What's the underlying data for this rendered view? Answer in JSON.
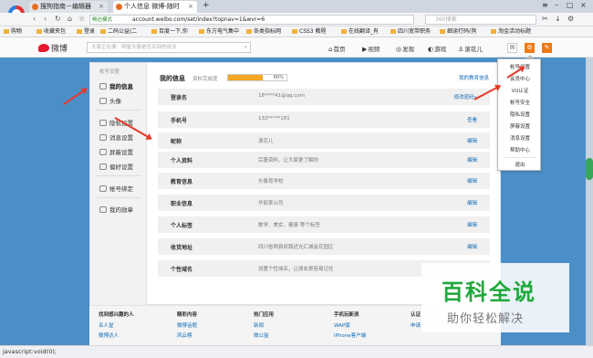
{
  "browser": {
    "tabs": [
      {
        "label": "搜狗指南－编辑器"
      },
      {
        "label": "个人信息 微博-随时"
      }
    ],
    "url_secure_label": "畅达模式",
    "url": "account.weibo.com/set/index?topnav=1&wvr=6",
    "search_placeholder": "360搜索",
    "bookmarks": [
      "购物",
      "收藏夹包",
      "登录",
      "二码公益|二",
      "百度一下,你",
      "东方电气集中",
      "各类指标网",
      "CSS3 教程",
      "在线翻译_有",
      "四川宽带职务",
      "细读打码(狗",
      "淘金活动标题"
    ]
  },
  "weibo": {
    "logo": "微博",
    "search_placeholder": "大家正在搜：明星头像是否买到的说法",
    "nav": [
      "首页",
      "视频",
      "发现",
      "游戏",
      "滚花儿"
    ]
  },
  "sidebar": {
    "header": "帐号设置",
    "items": [
      {
        "label": "我的信息"
      },
      {
        "label": "头像"
      },
      {
        "label": "隐私设置"
      },
      {
        "label": "消息设置"
      },
      {
        "label": "屏蔽设置"
      },
      {
        "label": "偏好设置"
      },
      {
        "label": "帐号绑定"
      },
      {
        "label": "我的勋章"
      }
    ]
  },
  "main": {
    "title": "我的信息",
    "level_label": "资料完成度",
    "progress_pct": "60%",
    "progress_value": 0.6,
    "top_link": "我的教育信息",
    "rows": [
      {
        "label": "登录名",
        "value": "18****41@qq.com",
        "action": "修改密码»"
      },
      {
        "label": "手机号",
        "value": "132*****181",
        "action": "查看"
      },
      {
        "label": "昵称",
        "value": "滚花儿",
        "action": "编辑"
      },
      {
        "label": "个人资料",
        "value": "完善资料，让大家更了解你",
        "action": "编辑"
      },
      {
        "label": "教育信息",
        "value": "头像育学校",
        "action": "编辑"
      },
      {
        "label": "职业信息",
        "value": "华丽某公司",
        "action": "编辑"
      },
      {
        "label": "个人标签",
        "value": "数学、美女、健康 等个标签",
        "action": "编辑"
      },
      {
        "label": "收货地址",
        "value": "四川省明县府路近光汇城金花园区",
        "action": "编辑"
      },
      {
        "label": "个性域名",
        "value": "设置个性域名，让朋友更容易记住",
        "action": ""
      }
    ]
  },
  "dropdown": [
    "帐号设置",
    "会员中心",
    "VU认证",
    "帐号安全",
    "隐私设置",
    "屏蔽设置",
    "消息设置",
    "帮助中心",
    "退出"
  ],
  "footer": {
    "cols": [
      {
        "head": "找到感兴趣的人",
        "links": [
          "名人堂",
          "微博达人",
          "微博会员"
        ]
      },
      {
        "head": "精彩内容",
        "links": [
          "微博话题",
          "风云榜",
          "微活动"
        ]
      },
      {
        "head": "热门应用",
        "links": [
          "新闻",
          "微公益",
          "微博",
          "小游戏"
        ]
      },
      {
        "head": "手机玩新浪",
        "links": [
          "WAP版",
          "iPhone客户端",
          "Android客户端"
        ]
      },
      {
        "head": "认证",
        "links": [
          "申请",
          "企业",
          "媒体"
        ]
      }
    ]
  },
  "status_text": "javascript:void(0);",
  "watermark": {
    "big": "百科全说",
    "small": "助你轻松解决"
  },
  "colors": {
    "accent": "#0d6ab7",
    "brand": "#e6162d",
    "annotation": "#e53a2c",
    "watermark": "#20a83b"
  }
}
